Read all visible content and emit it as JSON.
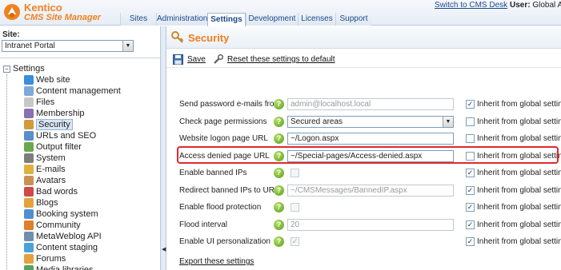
{
  "header": {
    "logo_line1": "Kentico",
    "logo_line2": "CMS Site Manager",
    "tabs": [
      "Sites",
      "Administration",
      "Settings",
      "Development",
      "Licenses",
      "Support"
    ],
    "active_tab": "Settings",
    "switch_link": "Switch to CMS Desk",
    "user_label": "User:",
    "user_name": "Global Ad"
  },
  "sidebar": {
    "site_label": "Site:",
    "site_value": "Intranet Portal",
    "root_label": "Settings",
    "items": [
      {
        "label": "Web site",
        "icon": "globe-icon",
        "color": "#3a8fd6"
      },
      {
        "label": "Content management",
        "icon": "document-icon",
        "color": "#7fa9d6"
      },
      {
        "label": "Files",
        "icon": "file-icon",
        "color": "#c7c7c7"
      },
      {
        "label": "Membership",
        "icon": "membership-icon",
        "color": "#8a6fb3"
      },
      {
        "label": "Security",
        "icon": "security-icon",
        "color": "#d39a3a"
      },
      {
        "label": "URLs and SEO",
        "icon": "url-icon",
        "color": "#5a8ec8"
      },
      {
        "label": "Output filter",
        "icon": "filter-icon",
        "color": "#6aa84f"
      },
      {
        "label": "System",
        "icon": "system-icon",
        "color": "#7d7d7d"
      },
      {
        "label": "E-mails",
        "icon": "email-icon",
        "color": "#e0b13d"
      },
      {
        "label": "Avatars",
        "icon": "avatar-icon",
        "color": "#c79254"
      },
      {
        "label": "Bad words",
        "icon": "bad-words-icon",
        "color": "#d04848"
      },
      {
        "label": "Blogs",
        "icon": "blog-icon",
        "color": "#e3a33c"
      },
      {
        "label": "Booking system",
        "icon": "calendar-icon",
        "color": "#4f8fcf"
      },
      {
        "label": "Community",
        "icon": "community-icon",
        "color": "#e07f2b"
      },
      {
        "label": "MetaWeblog API",
        "icon": "api-icon",
        "color": "#6f8faf"
      },
      {
        "label": "Content staging",
        "icon": "staging-icon",
        "color": "#4aa3d8"
      },
      {
        "label": "Forums",
        "icon": "forum-icon",
        "color": "#e3a33c"
      },
      {
        "label": "Media libraries",
        "icon": "media-icon",
        "color": "#58a35a"
      }
    ],
    "selected": "Security"
  },
  "main": {
    "title": "Security",
    "save_label": "Save",
    "reset_label": "Reset these settings to default",
    "inherit_label": "Inherit from global settings",
    "export_label": "Export these settings",
    "rows": [
      {
        "label": "Send password e-mails from",
        "kind": "text",
        "value": "admin@localhost.local",
        "disabled": true,
        "inherit": true
      },
      {
        "label": "Check page permissions",
        "kind": "select",
        "value": "Secured areas",
        "disabled": false,
        "inherit": false
      },
      {
        "label": "Website logon page URL",
        "kind": "text",
        "value": "~/Logon.aspx",
        "disabled": false,
        "inherit": false
      },
      {
        "label": "Access denied page URL",
        "kind": "text",
        "value": "~/Special-pages/Access-denied.aspx",
        "disabled": false,
        "inherit": false
      },
      {
        "label": "Enable banned IPs",
        "kind": "check",
        "value": "",
        "disabled": true,
        "inherit": true
      },
      {
        "label": "Redirect banned IPs to URL",
        "kind": "text",
        "value": "~/CMSMessages/BannedIP.aspx",
        "disabled": true,
        "inherit": true
      },
      {
        "label": "Enable flood protection",
        "kind": "check",
        "value": "",
        "disabled": true,
        "inherit": true
      },
      {
        "label": "Flood interval",
        "kind": "text",
        "value": "20",
        "disabled": true,
        "inherit": true
      },
      {
        "label": "Enable UI personalization",
        "kind": "check",
        "value": "checked",
        "disabled": true,
        "inherit": true
      }
    ]
  },
  "colors": {
    "accent_orange": "#f07d1a",
    "highlight_red": "#e0282e",
    "link_blue": "#1a4b8a"
  }
}
